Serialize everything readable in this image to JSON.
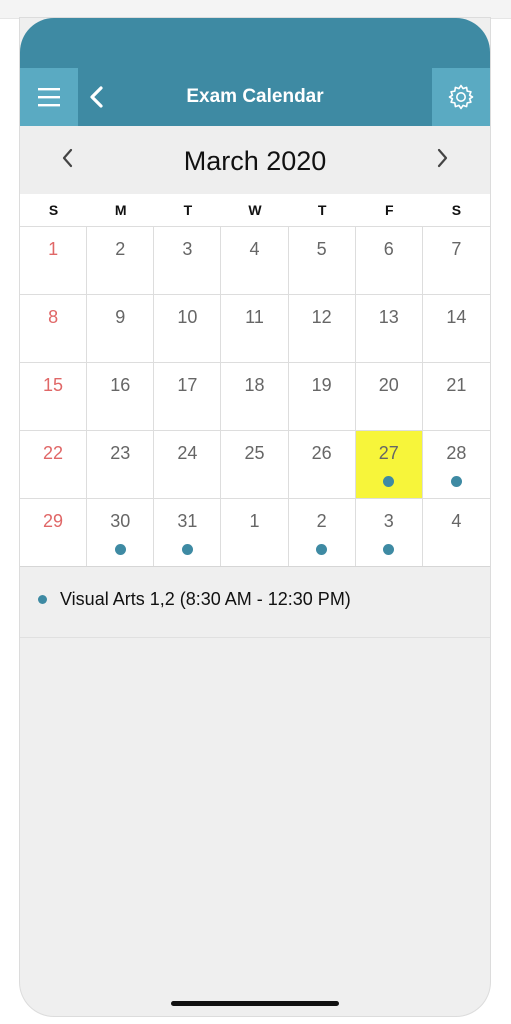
{
  "header": {
    "title": "Exam Calendar",
    "color": "#3e8aa3",
    "button_color": "#5aaac2",
    "icons": [
      "hamburger-menu-icon",
      "chevron-left-icon",
      "gear-icon"
    ]
  },
  "calendar": {
    "month_title": "March 2020",
    "weekdays": [
      "S",
      "M",
      "T",
      "W",
      "T",
      "F",
      "S"
    ],
    "days": [
      {
        "label": "1",
        "sunday": true,
        "event": false
      },
      {
        "label": "2",
        "event": false
      },
      {
        "label": "3",
        "event": false
      },
      {
        "label": "4",
        "event": false
      },
      {
        "label": "5",
        "event": false
      },
      {
        "label": "6",
        "event": false
      },
      {
        "label": "7",
        "event": false
      },
      {
        "label": "8",
        "sunday": true,
        "event": false
      },
      {
        "label": "9",
        "event": false
      },
      {
        "label": "10",
        "event": false
      },
      {
        "label": "11",
        "event": false
      },
      {
        "label": "12",
        "event": false
      },
      {
        "label": "13",
        "event": false
      },
      {
        "label": "14",
        "event": false
      },
      {
        "label": "15",
        "sunday": true,
        "event": false
      },
      {
        "label": "16",
        "event": false
      },
      {
        "label": "17",
        "event": false
      },
      {
        "label": "18",
        "event": false
      },
      {
        "label": "19",
        "event": false
      },
      {
        "label": "20",
        "event": false
      },
      {
        "label": "21",
        "event": false
      },
      {
        "label": "22",
        "sunday": true,
        "event": false
      },
      {
        "label": "23",
        "event": false
      },
      {
        "label": "24",
        "event": false
      },
      {
        "label": "25",
        "event": false
      },
      {
        "label": "26",
        "event": false
      },
      {
        "label": "27",
        "event": true,
        "selected": true
      },
      {
        "label": "28",
        "event": true
      },
      {
        "label": "29",
        "sunday": true,
        "event": false
      },
      {
        "label": "30",
        "event": true
      },
      {
        "label": "31",
        "event": true
      },
      {
        "label": "1",
        "event": false
      },
      {
        "label": "2",
        "event": true
      },
      {
        "label": "3",
        "event": true
      },
      {
        "label": "4",
        "event": false
      }
    ],
    "selected_color": "#f7f53a",
    "event_dot_color": "#3e8aa3",
    "sunday_color": "#e06767"
  },
  "events": [
    {
      "text": "Visual Arts 1,2 (8:30 AM - 12:30 PM)"
    }
  ]
}
